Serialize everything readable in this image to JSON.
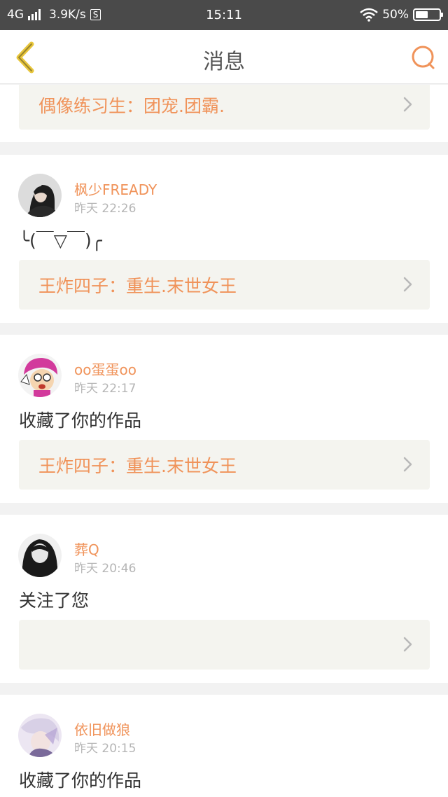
{
  "status_bar": {
    "network": "4G",
    "speed": "3.9K/s",
    "notif_badge": "S",
    "time": "15:11",
    "battery": "50%",
    "battery_level": 0.5
  },
  "header": {
    "title": "消息",
    "back_icon": "chevron-left-icon",
    "search_icon": "search-icon"
  },
  "colors": {
    "accent": "#f0935a",
    "back_icon": "#e8c63c",
    "ref_bg": "#f4f4ef"
  },
  "partial_top": {
    "ref_label": "偶像练习生：团宠.团霸."
  },
  "messages": [
    {
      "user": "枫少FREADY",
      "time": "昨天  22:26",
      "content": "╰(￣▽￣)╭",
      "ref_label": "王炸四子：重生.末世女王"
    },
    {
      "user": "oo蛋蛋oo",
      "time": "昨天  22:17",
      "content": "收藏了你的作品",
      "ref_label": "王炸四子：重生.末世女王"
    },
    {
      "user": "葬Q",
      "time": "昨天  20:46",
      "content": "关注了您",
      "ref_label": ""
    },
    {
      "user": "依旧做狼",
      "time": "昨天  20:15",
      "content": "收藏了你的作品"
    }
  ]
}
